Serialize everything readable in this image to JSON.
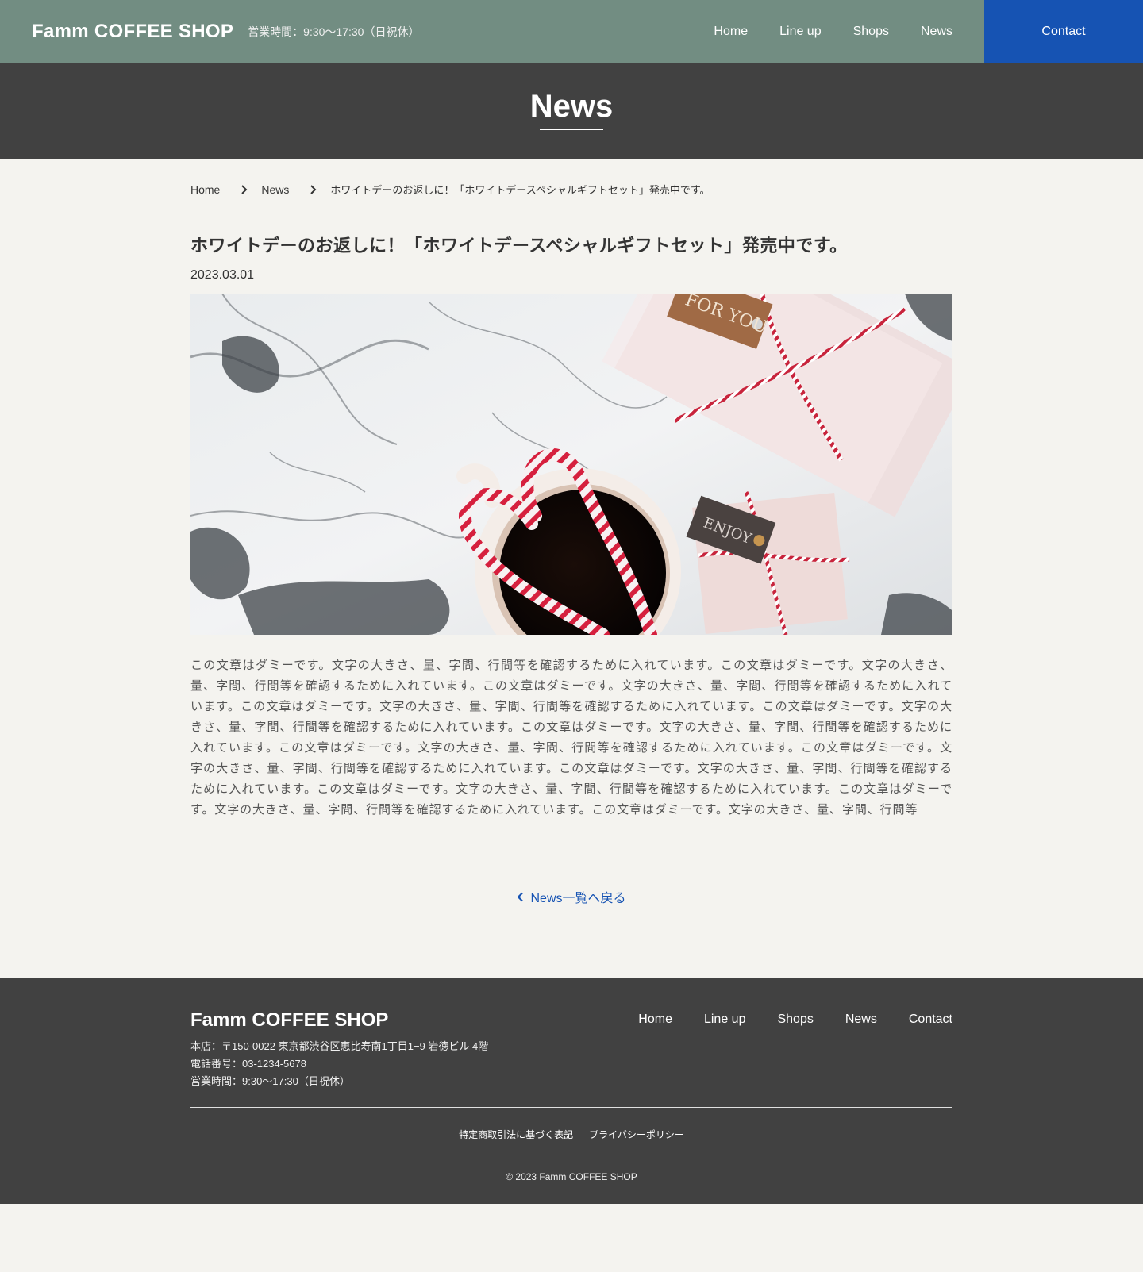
{
  "header": {
    "logo": "Famm COFFEE SHOP",
    "hours": "営業時間：9:30〜17:30（日祝休）",
    "nav": [
      "Home",
      "Line up",
      "Shops",
      "News"
    ],
    "contact": "Contact"
  },
  "band": {
    "title": "News"
  },
  "breadcrumb": {
    "home": "Home",
    "news": "News",
    "current": "ホワイトデーのお返しに！「ホワイトデースペシャルギフトセット」発売中です。"
  },
  "article": {
    "title": "ホワイトデーのお返しに！「ホワイトデースペシャルギフトセット」発売中です。",
    "date": "2023.03.01",
    "image_tags": [
      "FOR YOU",
      "ENJOY"
    ],
    "body": "この文章はダミーです。文字の大きさ、量、字間、行間等を確認するために入れています。この文章はダミーです。文字の大きさ、量、字間、行間等を確認するために入れています。この文章はダミーです。文字の大きさ、量、字間、行間等を確認するために入れています。この文章はダミーです。文字の大きさ、量、字間、行間等を確認するために入れています。この文章はダミーです。文字の大きさ、量、字間、行間等を確認するために入れています。この文章はダミーです。文字の大きさ、量、字間、行間等を確認するために入れています。この文章はダミーです。文字の大きさ、量、字間、行間等を確認するために入れています。この文章はダミーです。文字の大きさ、量、字間、行間等を確認するために入れています。この文章はダミーです。文字の大きさ、量、字間、行間等を確認するために入れています。この文章はダミーです。文字の大きさ、量、字間、行間等を確認するために入れています。この文章はダミーです。文字の大きさ、量、字間、行間等を確認するために入れています。この文章はダミーです。文字の大きさ、量、字間、行間等"
  },
  "back_link": "News一覧へ戻る",
  "footer": {
    "logo": "Famm COFFEE SHOP",
    "address": "本店：〒150-0022 東京都渋谷区恵比寿南1丁目1−9 岩徳ビル 4階",
    "phone": "電話番号：03-1234-5678",
    "hours": "営業時間：9:30〜17:30（日祝休）",
    "nav": [
      "Home",
      "Line up",
      "Shops",
      "News",
      "Contact"
    ],
    "legal": [
      "特定商取引法に基づく表記",
      "プライバシーポリシー"
    ],
    "copyright": "© 2023 Famm COFFEE SHOP"
  },
  "colors": {
    "header_bg": "#728d82",
    "contact_bg": "#1653b3",
    "band_bg": "#414141",
    "page_bg": "#f4f3ef",
    "link": "#1653b3"
  }
}
